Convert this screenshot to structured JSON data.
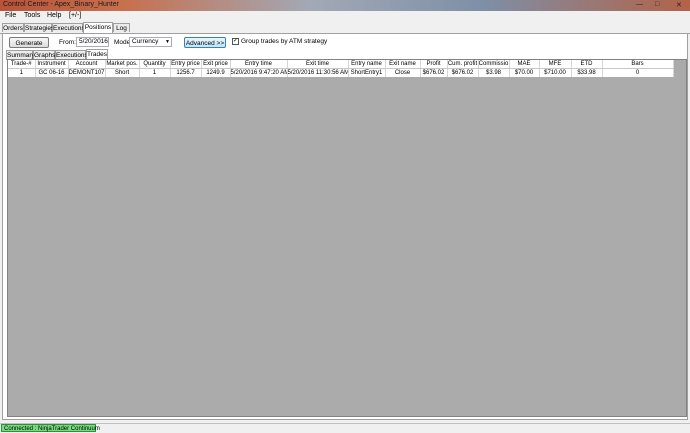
{
  "window": {
    "title": "Control Center - Apex_Binary_Hunter"
  },
  "menu": [
    "File",
    "Tools",
    "Help",
    "[+/-]"
  ],
  "main_tabs": [
    "Orders",
    "Strategies",
    "Executions",
    "Positions",
    "Log"
  ],
  "toolbar": {
    "generate_label": "Generate",
    "from_label": "From:",
    "from_value": "5/20/2016",
    "mode_label": "Mode:",
    "mode_value": "Currency",
    "advanced_label": "Advanced >>",
    "group_trades_label": "Group trades by ATM strategy",
    "group_trades_checked": true
  },
  "sub_tabs": [
    "Summary",
    "Graphs",
    "Executions",
    "Trades"
  ],
  "table": {
    "columns": [
      "Trade-#",
      "Instrument",
      "Account",
      "Market pos.",
      "Quantity",
      "Entry price",
      "Exit price",
      "Entry time",
      "Exit time",
      "Entry name",
      "Exit name",
      "Profit",
      "Cum. profit",
      "Commissio",
      "MAE",
      "MFE",
      "ETD",
      "Bars"
    ],
    "rows": [
      [
        "1",
        "GC 06-16",
        "DEMONT107",
        "Short",
        "1",
        "1256.7",
        "1249.9",
        "5/20/2016 9:47:20 AM",
        "5/20/2016 11:30:56 AM",
        "ShortEntry1",
        "Close",
        "$676.02",
        "$676.02",
        "$3.98",
        "$70.00",
        "$710.00",
        "$33.98",
        "0"
      ]
    ]
  },
  "status": {
    "connection": "Connected : NinjaTrader Continuum"
  }
}
